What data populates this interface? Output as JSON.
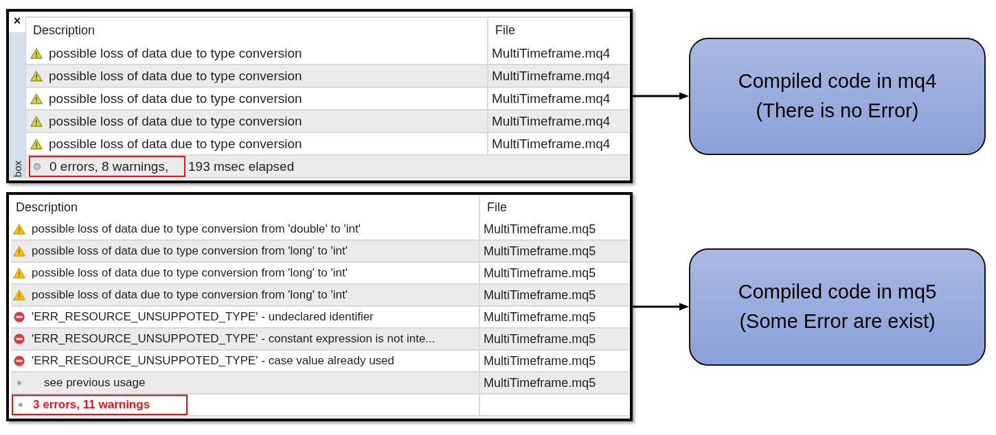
{
  "sections": [
    {
      "panel": {
        "kind": "docked",
        "side_tab": {
          "close": "×",
          "label": "box"
        },
        "columns": [
          "Description",
          "File"
        ],
        "rows": [
          {
            "kind": "warning",
            "description": "possible loss of data due to type conversion",
            "file": "MultiTimeframe.mq4"
          },
          {
            "kind": "warning",
            "description": "possible loss of data due to type conversion",
            "file": "MultiTimeframe.mq4"
          },
          {
            "kind": "warning",
            "description": "possible loss of data due to type conversion",
            "file": "MultiTimeframe.mq4"
          },
          {
            "kind": "warning",
            "description": "possible loss of data due to type conversion",
            "file": "MultiTimeframe.mq4"
          },
          {
            "kind": "warning",
            "description": "possible loss of data due to type conversion",
            "file": "MultiTimeframe.mq4"
          }
        ],
        "status": {
          "summary": "0 errors, 8 warnings,",
          "timing": "193 msec elapsed",
          "failed": false,
          "highlighted": true
        }
      },
      "callout": {
        "title": "Compiled code in mq4",
        "note": "(There is no Error)"
      }
    },
    {
      "panel": {
        "kind": "plain",
        "columns": [
          "Description",
          "File"
        ],
        "rows": [
          {
            "kind": "warning",
            "description": "possible loss of data due to type conversion from 'double' to 'int'",
            "file": "MultiTimeframe.mq5"
          },
          {
            "kind": "warning",
            "description": "possible loss of data due to type conversion from 'long' to 'int'",
            "file": "MultiTimeframe.mq5"
          },
          {
            "kind": "warning",
            "description": "possible loss of data due to type conversion from 'long' to 'int'",
            "file": "MultiTimeframe.mq5"
          },
          {
            "kind": "warning",
            "description": "possible loss of data due to type conversion from 'long' to 'int'",
            "file": "MultiTimeframe.mq5"
          },
          {
            "kind": "error",
            "description": "'ERR_RESOURCE_UNSUPPOTED_TYPE' - undeclared identifier",
            "file": "MultiTimeframe.mq5"
          },
          {
            "kind": "error",
            "description": "'ERR_RESOURCE_UNSUPPOTED_TYPE' - constant expression is not inte...",
            "file": "MultiTimeframe.mq5"
          },
          {
            "kind": "error",
            "description": "'ERR_RESOURCE_UNSUPPOTED_TYPE' - case value already used",
            "file": "MultiTimeframe.mq5",
            "children": [
              {
                "kind": "note",
                "description": "see previous usage",
                "file": "MultiTimeframe.mq5"
              }
            ]
          }
        ],
        "status": {
          "summary": "3 errors, 11 warnings",
          "failed": true,
          "highlighted": true
        }
      },
      "callout": {
        "title": "Compiled code in mq5",
        "note": "(Some Error are exist)"
      }
    }
  ]
}
